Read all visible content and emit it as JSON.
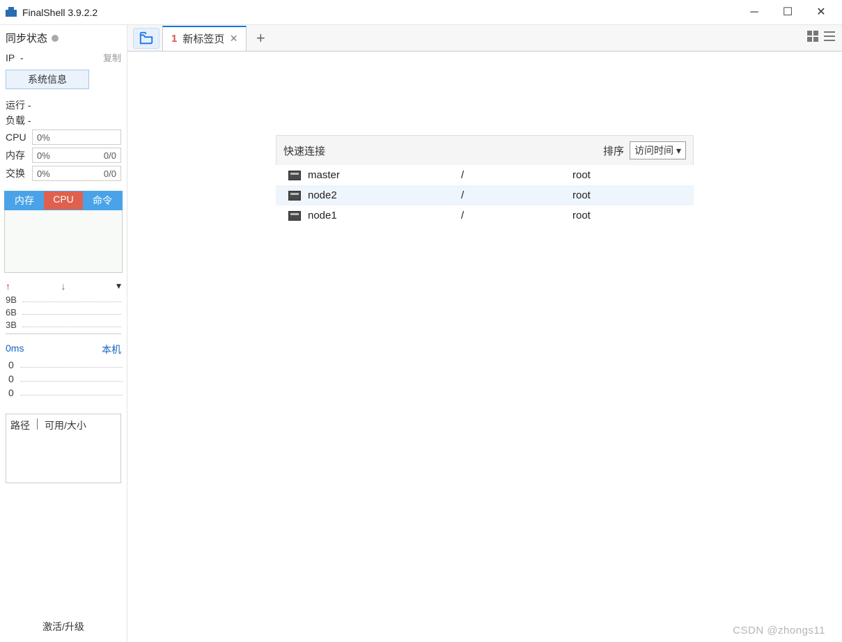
{
  "titlebar": {
    "title": "FinalShell 3.9.2.2"
  },
  "sidebar": {
    "sync_label": "同步状态",
    "ip_label": "IP",
    "ip_value": "-",
    "copy_label": "复制",
    "sysinfo_btn": "系统信息",
    "running_label": "运行",
    "running_value": "-",
    "load_label": "负载",
    "load_value": "-",
    "cpu_label": "CPU",
    "cpu_value": "0%",
    "mem_label": "内存",
    "mem_value_left": "0%",
    "mem_value_right": "0/0",
    "swap_label": "交换",
    "swap_value_left": "0%",
    "swap_value_right": "0/0",
    "tabs": {
      "mem": "内存",
      "cpu": "CPU",
      "cmd": "命令"
    },
    "graph_ticks": [
      "9B",
      "6B",
      "3B"
    ],
    "ms": "0ms",
    "local": "本机",
    "zeros": [
      "0",
      "0",
      "0"
    ],
    "path_hdr": {
      "path": "路径",
      "size": "可用/大小"
    },
    "activate": "激活/升级"
  },
  "tabbar": {
    "tab_num": "1",
    "tab_label": "新标签页"
  },
  "quick": {
    "title": "快速连接",
    "sort_label": "排序",
    "sort_value": "访问时间",
    "rows": [
      {
        "name": "master",
        "path": "/",
        "user": "root"
      },
      {
        "name": "node2",
        "path": "/",
        "user": "root"
      },
      {
        "name": "node1",
        "path": "/",
        "user": "root"
      }
    ]
  },
  "watermark": "CSDN @zhongs11"
}
